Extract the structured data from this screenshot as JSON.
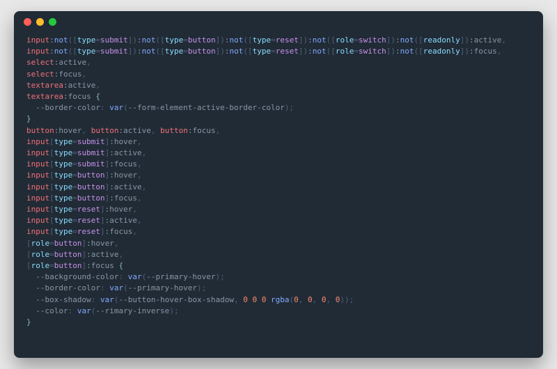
{
  "window": {
    "controls": [
      "close",
      "minimize",
      "zoom"
    ]
  },
  "code": {
    "block1": {
      "selectors": [
        {
          "tag": "input",
          "nots": [
            [
              "type",
              "submit"
            ],
            [
              "type",
              "button"
            ],
            [
              "type",
              "reset"
            ],
            [
              "role",
              "switch"
            ],
            [
              "readonly",
              null
            ]
          ],
          "pseudo": "active",
          "comma": true
        },
        {
          "tag": "input",
          "nots": [
            [
              "type",
              "submit"
            ],
            [
              "type",
              "button"
            ],
            [
              "type",
              "reset"
            ],
            [
              "role",
              "switch"
            ],
            [
              "readonly",
              null
            ]
          ],
          "pseudo": "focus",
          "comma": true
        },
        {
          "tag": "select",
          "pseudo": "active",
          "comma": true
        },
        {
          "tag": "select",
          "pseudo": "focus",
          "comma": true
        },
        {
          "tag": "textarea",
          "pseudo": "active",
          "comma": true
        },
        {
          "tag": "textarea",
          "pseudo": "focus",
          "comma": false,
          "open": true
        }
      ],
      "decls": [
        {
          "prop": "--border-color",
          "fn": "var",
          "args_var": "--form-element-active-border-color"
        }
      ]
    },
    "block2": {
      "selectors_line1": [
        {
          "tag": "button",
          "pseudo": "hover"
        },
        {
          "tag": "button",
          "pseudo": "active"
        },
        {
          "tag": "button",
          "pseudo": "focus"
        }
      ],
      "selectors": [
        {
          "tag": "input",
          "attr": [
            "type",
            "submit"
          ],
          "pseudo": "hover",
          "comma": true
        },
        {
          "tag": "input",
          "attr": [
            "type",
            "submit"
          ],
          "pseudo": "active",
          "comma": true
        },
        {
          "tag": "input",
          "attr": [
            "type",
            "submit"
          ],
          "pseudo": "focus",
          "comma": true
        },
        {
          "tag": "input",
          "attr": [
            "type",
            "button"
          ],
          "pseudo": "hover",
          "comma": true
        },
        {
          "tag": "input",
          "attr": [
            "type",
            "button"
          ],
          "pseudo": "active",
          "comma": true
        },
        {
          "tag": "input",
          "attr": [
            "type",
            "button"
          ],
          "pseudo": "focus",
          "comma": true
        },
        {
          "tag": "input",
          "attr": [
            "type",
            "reset"
          ],
          "pseudo": "hover",
          "comma": true
        },
        {
          "tag": "input",
          "attr": [
            "type",
            "reset"
          ],
          "pseudo": "active",
          "comma": true
        },
        {
          "tag": "input",
          "attr": [
            "type",
            "reset"
          ],
          "pseudo": "focus",
          "comma": true
        },
        {
          "attr_only": [
            "role",
            "button"
          ],
          "pseudo": "hover",
          "comma": true
        },
        {
          "attr_only": [
            "role",
            "button"
          ],
          "pseudo": "active",
          "comma": true
        },
        {
          "attr_only": [
            "role",
            "button"
          ],
          "pseudo": "focus",
          "comma": false,
          "open": true
        }
      ],
      "decls": [
        {
          "prop": "--background-color",
          "fn": "var",
          "args_var": "--primary-hover"
        },
        {
          "prop": "--border-color",
          "fn": "var",
          "args_var": "--primary-hover"
        },
        {
          "prop": "--box-shadow",
          "fn": "var",
          "args_var": "--button-hover-box-shadow",
          "fallback_nums": [
            "0",
            "0",
            "0"
          ],
          "fallback_fn": "rgba",
          "fallback_args": [
            "0",
            "0",
            "0",
            "0"
          ]
        },
        {
          "prop": "--color",
          "fn": "var",
          "args_var": "--rimary-inverse"
        }
      ]
    }
  }
}
